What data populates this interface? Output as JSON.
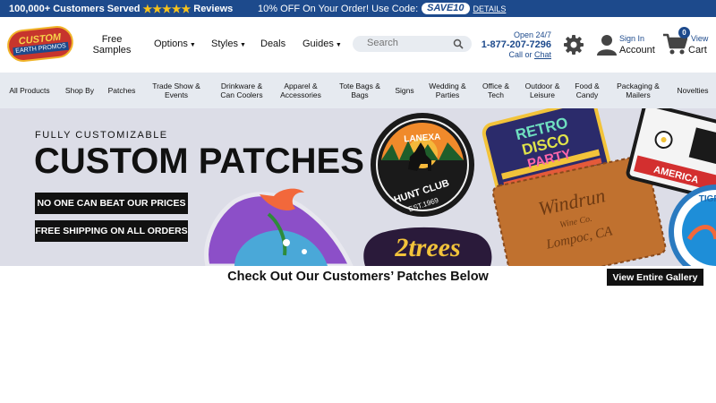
{
  "topbar": {
    "customers": "100,000+ Customers Served",
    "stars": "★★★★★",
    "reviews": "Reviews",
    "offer": "10% OFF On Your Order! Use Code:",
    "code": "SAVE10",
    "details": "DETAILS"
  },
  "logo": {
    "line1": "CUSTOM",
    "line2": "EARTH PROMOS"
  },
  "nav": {
    "free_samples": "Free Samples",
    "options": "Options",
    "styles": "Styles",
    "deals": "Deals",
    "guides": "Guides"
  },
  "search": {
    "placeholder": "Search"
  },
  "contact": {
    "open": "Open 24/7",
    "phone": "1-877-207-7296",
    "call": "Call or",
    "chat": "Chat"
  },
  "account": {
    "sign_in": "Sign In",
    "label": "Account"
  },
  "cart": {
    "count": "0",
    "view": "View",
    "label": "Cart"
  },
  "categories": [
    "All Products",
    "Shop By",
    "Patches",
    "Trade Show & Events",
    "Drinkware & Can Coolers",
    "Apparel & Accessories",
    "Tote Bags & Bags",
    "Signs",
    "Wedding & Parties",
    "Office & Tech",
    "Outdoor & Leisure",
    "Food & Candy",
    "Packaging & Mailers",
    "Novelties"
  ],
  "hero": {
    "kicker": "FULLY CUSTOMIZABLE",
    "title": "CUSTOM PATCHES",
    "cta1": "NO ONE CAN BEAT OUR PRICES",
    "cta2": "FREE SHIPPING ON ALL ORDERS",
    "patch_texts": [
      "LANEXA",
      "HUNT CLUB",
      "EST.1969",
      "RETRO",
      "DISCO",
      "PARTY",
      "Windrun",
      "Wine Co.",
      "Lompoc, CA",
      "2trees",
      "AMERICA",
      "TIGRE"
    ]
  },
  "gallery": {
    "heading": "Check Out Our Customers’ Patches Below",
    "button": "View Entire Gallery"
  },
  "colors": {
    "brand_blue": "#1d4a8c",
    "star_gold": "#f7c21a",
    "nav_bg": "#e6eaf0",
    "hero_bg": "#dcdde7"
  }
}
